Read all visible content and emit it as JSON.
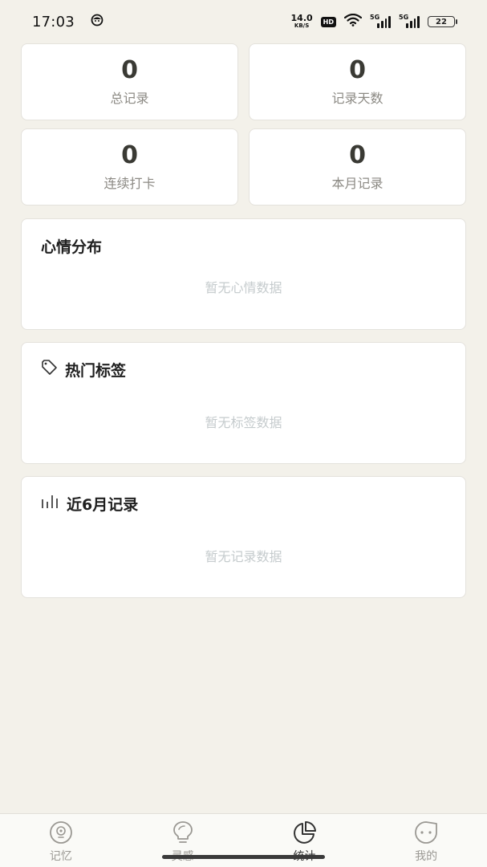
{
  "status_bar": {
    "time": "17:03",
    "net_speed_value": "14.0",
    "net_speed_unit": "KB/S",
    "hd_label": "HD",
    "signal_1_tag": "5G",
    "signal_2_tag": "5G",
    "battery": "22"
  },
  "stats": [
    {
      "value": "0",
      "label": "总记录"
    },
    {
      "value": "0",
      "label": "记录天数"
    },
    {
      "value": "0",
      "label": "连续打卡"
    },
    {
      "value": "0",
      "label": "本月记录"
    }
  ],
  "mood": {
    "title": "心情分布",
    "empty": "暂无心情数据"
  },
  "tags": {
    "title": "热门标签",
    "icon": "tag-icon",
    "empty": "暂无标签数据"
  },
  "records": {
    "title": "近6月记录",
    "icon": "bar-chart-icon",
    "empty": "暂无记录数据"
  },
  "tab_bar": {
    "items": [
      {
        "label": "记忆",
        "icon": "memory-icon"
      },
      {
        "label": "灵感",
        "icon": "lightbulb-icon"
      },
      {
        "label": "统计",
        "icon": "pie-chart-icon",
        "active": true
      },
      {
        "label": "我的",
        "icon": "smile-face-icon"
      }
    ]
  },
  "colors": {
    "background": "#f3f1ea",
    "card": "#ffffff",
    "muted_text": "#8c8a84",
    "empty_text": "#c5cbcd"
  }
}
